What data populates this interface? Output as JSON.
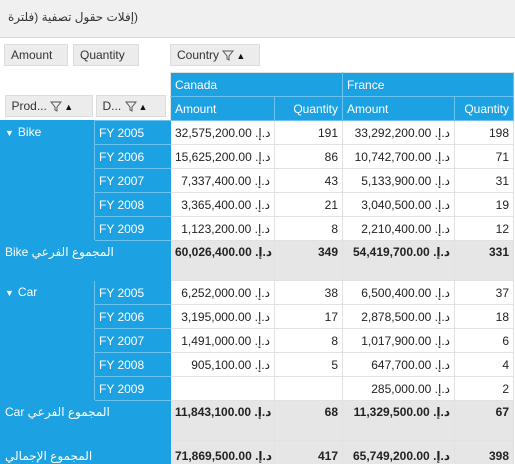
{
  "filter_area": {
    "label": "(إفلات حقول تصفية (فلترة"
  },
  "values_chips": [
    "Amount",
    "Quantity"
  ],
  "column_chip": {
    "label": "Country"
  },
  "row_chips": [
    "Prod...",
    "D..."
  ],
  "countries": [
    "Canada",
    "France"
  ],
  "measures": {
    "amount": "Amount",
    "quantity": "Quantity"
  },
  "currency": "د.إ.",
  "groups": [
    {
      "name": "Bike",
      "rows": [
        {
          "year": "FY 2005",
          "ca_amount": "32,575,200.00",
          "ca_qty": "191",
          "fr_amount": "33,292,200.00",
          "fr_qty": "198"
        },
        {
          "year": "FY 2006",
          "ca_amount": "15,625,200.00",
          "ca_qty": "86",
          "fr_amount": "10,742,700.00",
          "fr_qty": "71"
        },
        {
          "year": "FY 2007",
          "ca_amount": "7,337,400.00",
          "ca_qty": "43",
          "fr_amount": "5,133,900.00",
          "fr_qty": "31"
        },
        {
          "year": "FY 2008",
          "ca_amount": "3,365,400.00",
          "ca_qty": "21",
          "fr_amount": "3,040,500.00",
          "fr_qty": "19"
        },
        {
          "year": "FY 2009",
          "ca_amount": "1,123,200.00",
          "ca_qty": "8",
          "fr_amount": "2,210,400.00",
          "fr_qty": "12"
        }
      ],
      "subtotal_label": "المجموع الفرعي Bike",
      "subtotal": {
        "ca_amount": "60,026,400.00",
        "ca_qty": "349",
        "fr_amount": "54,419,700.00",
        "fr_qty": "331"
      }
    },
    {
      "name": "Car",
      "rows": [
        {
          "year": "FY 2005",
          "ca_amount": "6,252,000.00",
          "ca_qty": "38",
          "fr_amount": "6,500,400.00",
          "fr_qty": "37"
        },
        {
          "year": "FY 2006",
          "ca_amount": "3,195,000.00",
          "ca_qty": "17",
          "fr_amount": "2,878,500.00",
          "fr_qty": "18"
        },
        {
          "year": "FY 2007",
          "ca_amount": "1,491,000.00",
          "ca_qty": "8",
          "fr_amount": "1,017,900.00",
          "fr_qty": "6"
        },
        {
          "year": "FY 2008",
          "ca_amount": "905,100.00",
          "ca_qty": "5",
          "fr_amount": "647,700.00",
          "fr_qty": "4"
        },
        {
          "year": "FY 2009",
          "ca_amount": "",
          "ca_qty": "",
          "fr_amount": "285,000.00",
          "fr_qty": "2"
        }
      ],
      "subtotal_label": "المجموع الفرعي Car",
      "subtotal": {
        "ca_amount": "11,843,100.00",
        "ca_qty": "68",
        "fr_amount": "11,329,500.00",
        "fr_qty": "67"
      }
    }
  ],
  "grand_total_label": "المجموع الإجمالي",
  "grand_total": {
    "ca_amount": "71,869,500.00",
    "ca_qty": "417",
    "fr_amount": "65,749,200.00",
    "fr_qty": "398"
  },
  "colors": {
    "accent": "#1ca1e2",
    "subtotal_bg": "#e6e6e6"
  }
}
